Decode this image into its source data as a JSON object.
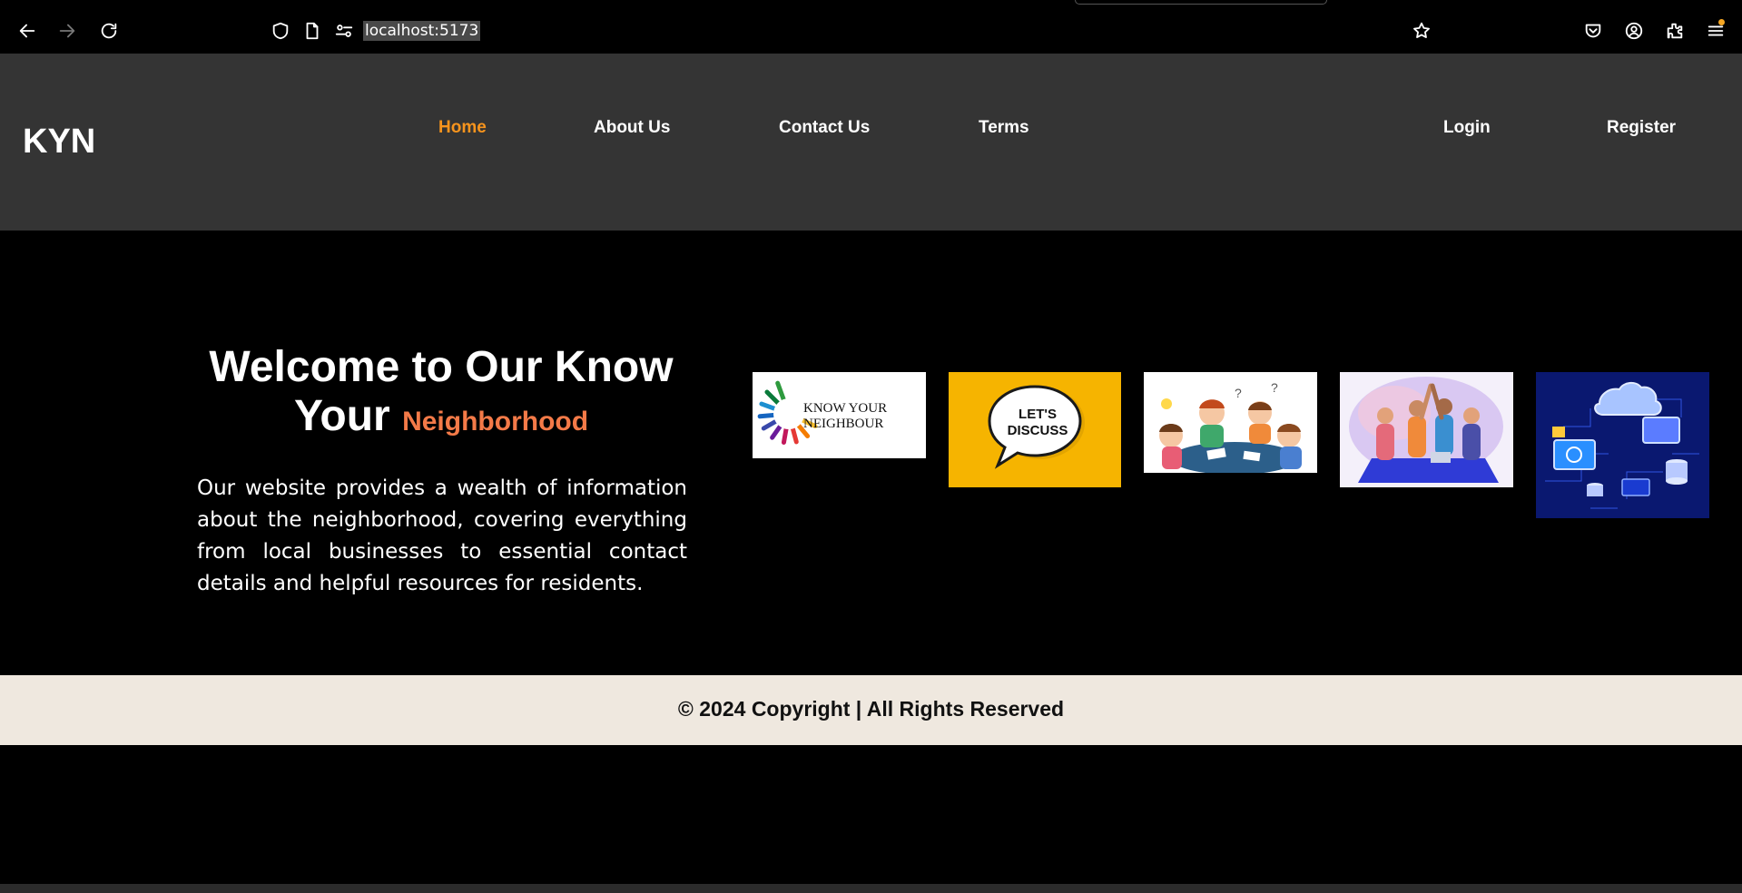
{
  "browser": {
    "url": "localhost:5173",
    "icons": [
      "back-arrow-icon",
      "forward-arrow-icon",
      "reload-icon",
      "shield-icon",
      "page-icon",
      "permissions-icon",
      "bookmark-star-icon",
      "pocket-icon",
      "account-icon",
      "extensions-icon",
      "menu-icon"
    ]
  },
  "header": {
    "logo": "KYN",
    "nav": {
      "home": "Home",
      "about": "About Us",
      "contact": "Contact Us",
      "terms": "Terms",
      "login": "Login",
      "register": "Register"
    },
    "active_color": "#f7941d"
  },
  "hero": {
    "title_main": "Welcome to Our Know Your",
    "title_accent": "Neighborhood",
    "accent_color": "#f47a48",
    "description": "Our website provides a wealth of information about the neighborhood, covering everything from local businesses to essential contact details and helpful resources for residents.",
    "images": {
      "know_your_neighbour_line1": "KNOW YOUR",
      "know_your_neighbour_line2": "NEIGHBOUR",
      "lets_discuss_line1": "LET'S",
      "lets_discuss_line2": "DISCUSS"
    }
  },
  "footer": {
    "text": "© 2024 Copyright | All Rights Reserved"
  }
}
